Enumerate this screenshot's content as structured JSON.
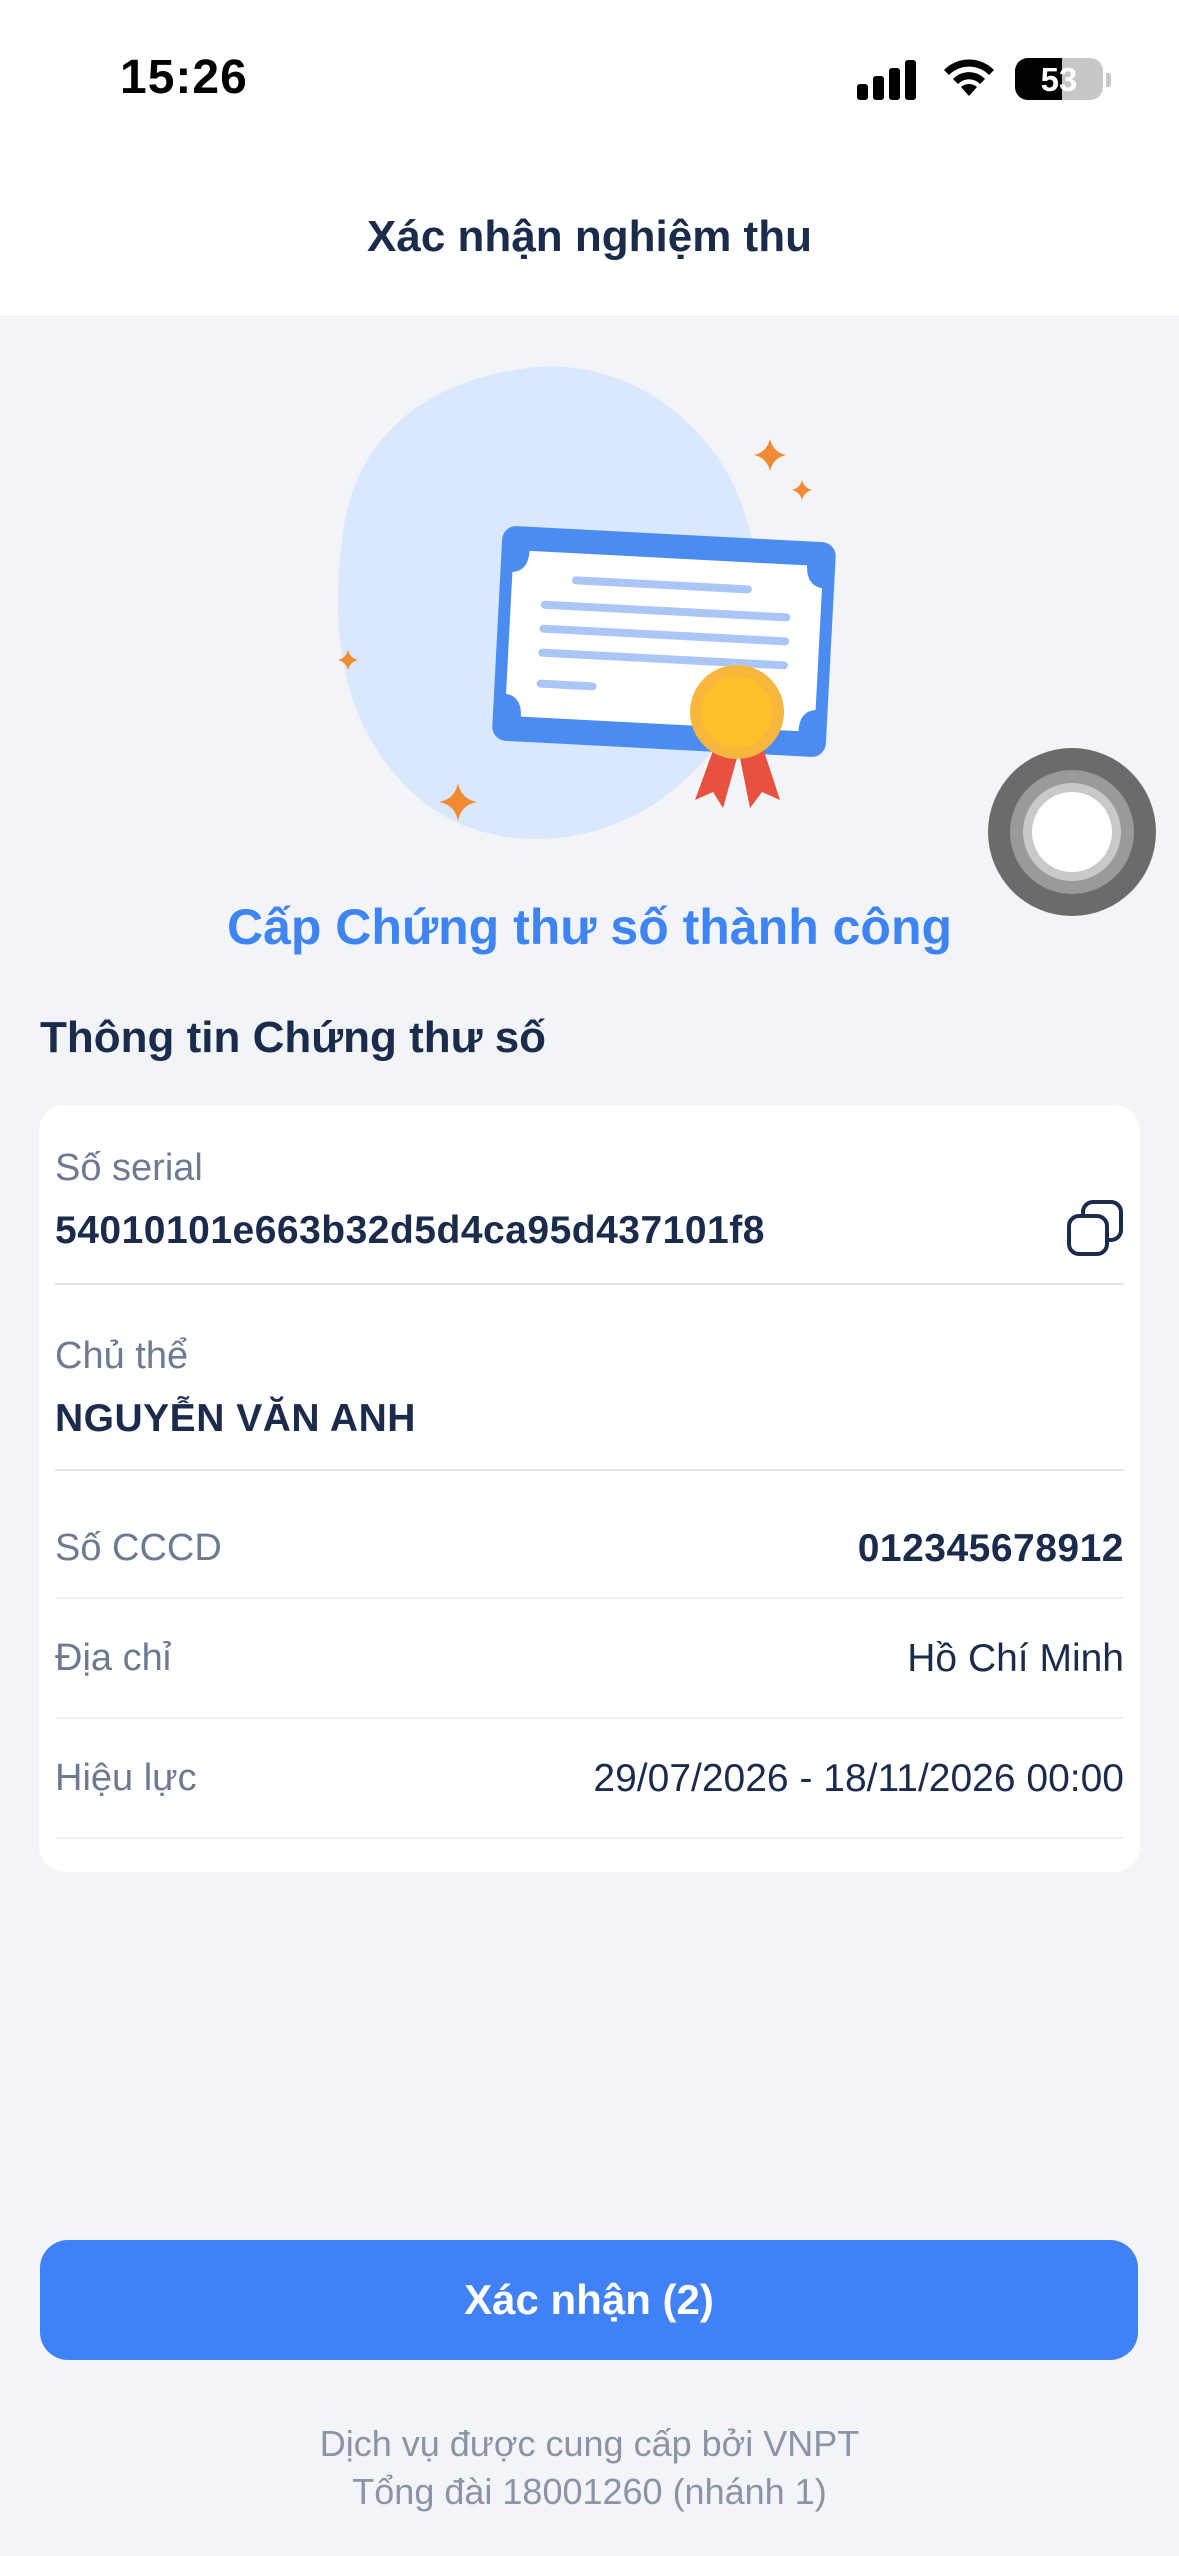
{
  "status_bar": {
    "time": "15:26",
    "battery": "53",
    "battery_level": 0.53
  },
  "header": {
    "title": "Xác nhận nghiệm thu"
  },
  "success": {
    "title": "Cấp Chứng thư số thành công"
  },
  "section": {
    "title": "Thông tin Chứng thư số"
  },
  "certificate": {
    "serial_label": "Số serial",
    "serial_value": "54010101e663b32d5d4ca95d437101f8",
    "subject_label": "Chủ thể",
    "subject_value": "NGUYỄN VĂN ANH",
    "cccd_label": "Số CCCD",
    "cccd_value": "012345678912",
    "address_label": "Địa chỉ",
    "address_value": "Hồ Chí Minh",
    "validity_label": "Hiệu lực",
    "validity_value": "29/07/2026 - 18/11/2026 00:00"
  },
  "actions": {
    "confirm_label": "Xác nhận (2)"
  },
  "footer": {
    "line1": "Dịch vụ được cung cấp bởi VNPT",
    "line2": "Tổng đài 18001260 (nhánh 1)"
  },
  "colors": {
    "primary": "#4081f5",
    "success_text": "#3f84f3",
    "dark_text": "#1a2b4c",
    "muted_text": "#6c7a92",
    "background": "#f2f4f8"
  },
  "icons": [
    "cellular-signal-icon",
    "wifi-icon",
    "battery-icon",
    "certificate-illustration",
    "copy-icon",
    "assistive-touch"
  ]
}
